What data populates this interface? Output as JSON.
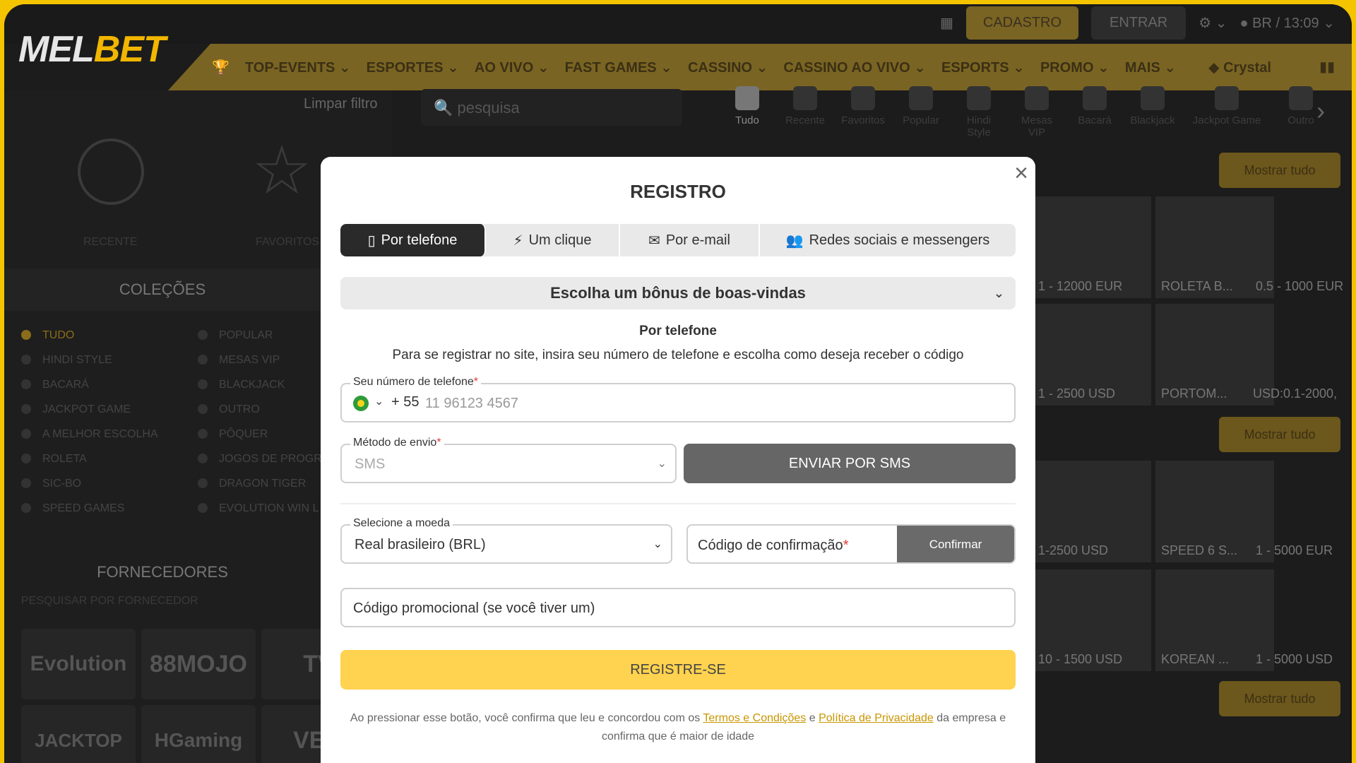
{
  "header": {
    "logo_left": "MEL",
    "logo_right": "BET",
    "cadastro": "CADASTRO",
    "entrar": "ENTRAR",
    "locale": "BR / 13:09"
  },
  "nav": {
    "items": [
      "TOP-EVENTS",
      "ESPORTES",
      "AO VIVO",
      "FAST GAMES",
      "CASSINO",
      "CASSINO AO VIVO",
      "ESPORTS",
      "PROMO",
      "MAIS"
    ],
    "crystal": "Crystal"
  },
  "sidebar": {
    "limpar": "Limpar filtro",
    "recente": "RECENTE",
    "favoritos": "FAVORITOS",
    "colecoes": "COLEÇÕES",
    "collections_left": [
      "TUDO",
      "HINDI STYLE",
      "BACARÁ",
      "JACKPOT GAME",
      "A MELHOR ESCOLHA",
      "ROLETA",
      "SIC-BO",
      "SPEED GAMES"
    ],
    "collections_right": [
      "POPULAR",
      "MESAS VIP",
      "BLACKJACK",
      "OUTRO",
      "PÔQUER",
      "JOGOS DE PROGR",
      "DRAGON TIGER",
      "EVOLUTION WIN L"
    ],
    "fornecedores": "FORNECEDORES",
    "pesquisar": "PESQUISAR POR FORNECEDOR",
    "providers": [
      "Evolution",
      "88MOJO",
      "TV",
      "JACKTOP",
      "HGaming",
      "VEG"
    ]
  },
  "main": {
    "search_placeholder": "pesquisa",
    "categories": [
      "Tudo",
      "Recente",
      "Favoritos",
      "Popular",
      "Hindi Style",
      "Mesas VIP",
      "Bacará",
      "Blackjack",
      "Jackpot Game",
      "Outro"
    ],
    "mostrar": "Mostrar tudo",
    "games": [
      "1 - 12000 EUR",
      "ROLETA B...",
      "0.5 - 1000 EUR",
      "1 - 2500 USD",
      "PORTOM...",
      "USD:0.1-2000,",
      "1-2500 USD",
      "SPEED 6 S...",
      "1 - 5000 EUR",
      "10 - 1500 USD",
      "KOREAN ...",
      "1 - 5000 USD"
    ]
  },
  "modal": {
    "title": "REGISTRO",
    "tabs": [
      "Por telefone",
      "Um clique",
      "Por e-mail",
      "Redes sociais e messengers"
    ],
    "bonus": "Escolha um bônus de boas-vindas",
    "section_title": "Por telefone",
    "section_desc": "Para se registrar no site, insira seu número de telefone e escolha como deseja receber o código",
    "phone_label": "Seu número de telefone",
    "phone_code": "+ 55",
    "phone_placeholder": "11 96123 4567",
    "metodo_label": "Método de envio",
    "metodo_value": "SMS",
    "sms_button": "ENVIAR POR SMS",
    "moeda_label": "Selecione a moeda",
    "moeda_value": "Real brasileiro (BRL)",
    "confirm_placeholder": "Código de confirmação",
    "confirm_button": "Confirmar",
    "promo_placeholder": "Código promocional (se você tiver um)",
    "register_button": "REGISTRE-SE",
    "terms_1": "Ao pressionar esse botão, você confirma que leu e concordou com os",
    "terms_link1": "Termos e Condições",
    "terms_and": "e",
    "terms_link2": "Política de Privacidade",
    "terms_2": "da empresa e confirma que é maior de idade"
  },
  "colors": {
    "accent": "#ffd24f",
    "dark": "#2a2a2a"
  }
}
